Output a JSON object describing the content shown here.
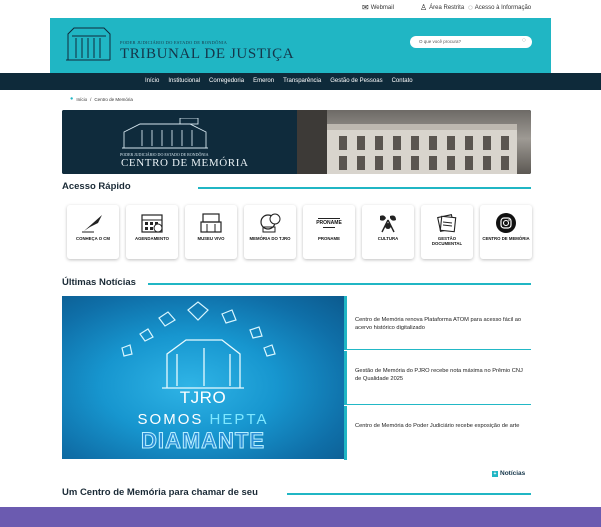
{
  "utility_bar": {
    "webmail": "Webmail",
    "restricted": "Área Restrita",
    "access_info": "Acesso à Informação"
  },
  "header": {
    "org_small": "Poder Judiciário do Estado de Rondônia",
    "org_big": "Tribunal de Justiça",
    "search_placeholder": "O que você procura?"
  },
  "nav": {
    "items": [
      "Início",
      "Institucional",
      "Corregedoria",
      "Emeron",
      "Transparência",
      "Gestão de Pessoas",
      "Contato"
    ]
  },
  "breadcrumb": {
    "home": "Início",
    "separator": "/",
    "current": "Centro de Memória"
  },
  "banner": {
    "small": "Poder Judiciário do Estado de Rondônia",
    "big": "Centro de Memória"
  },
  "quick_access": {
    "title": "Acesso Rápido",
    "cards": [
      {
        "label": "CONHEÇA O CM",
        "icon": "quill-icon"
      },
      {
        "label": "AGENDAMENTO",
        "icon": "calendar-icon"
      },
      {
        "label": "MUSEU VIVO",
        "icon": "museum-icon"
      },
      {
        "label": "MEMÓRIA DO TJRO",
        "icon": "memory-icon"
      },
      {
        "label": "PRONAME",
        "icon": "proname-icon"
      },
      {
        "label": "CULTURA",
        "icon": "culture-icon"
      },
      {
        "label": "GESTÃO DOCUMENTAL",
        "icon": "documents-icon"
      },
      {
        "label": "CENTRO DE MEMÓRIA",
        "icon": "instagram-icon"
      }
    ],
    "proname_logo_text": "PRONAME"
  },
  "news": {
    "title": "Últimas Notícias",
    "image_text": {
      "line1": "TJRO",
      "line2a": "SOMOS ",
      "line2b": "HEPTA",
      "line3": "DIAMANTE"
    },
    "items": [
      "Centro de Memória renova Plataforma ATOM para acesso fácil ao acervo histórico digitalizado",
      "Gestão de Memória do PJRO recebe nota máxima no Prêmio CNJ de Qualidade 2025",
      "Centro de Memória do Poder Judiciário recebe exposição de arte"
    ],
    "more_label": "Notícias",
    "more_icon": "plus-icon"
  },
  "bottom_section": {
    "title": "Um Centro de Memória para chamar de seu"
  },
  "colors": {
    "teal": "#20b6c4",
    "navy": "#0e2a3a",
    "purple": "#6b5bb0"
  }
}
